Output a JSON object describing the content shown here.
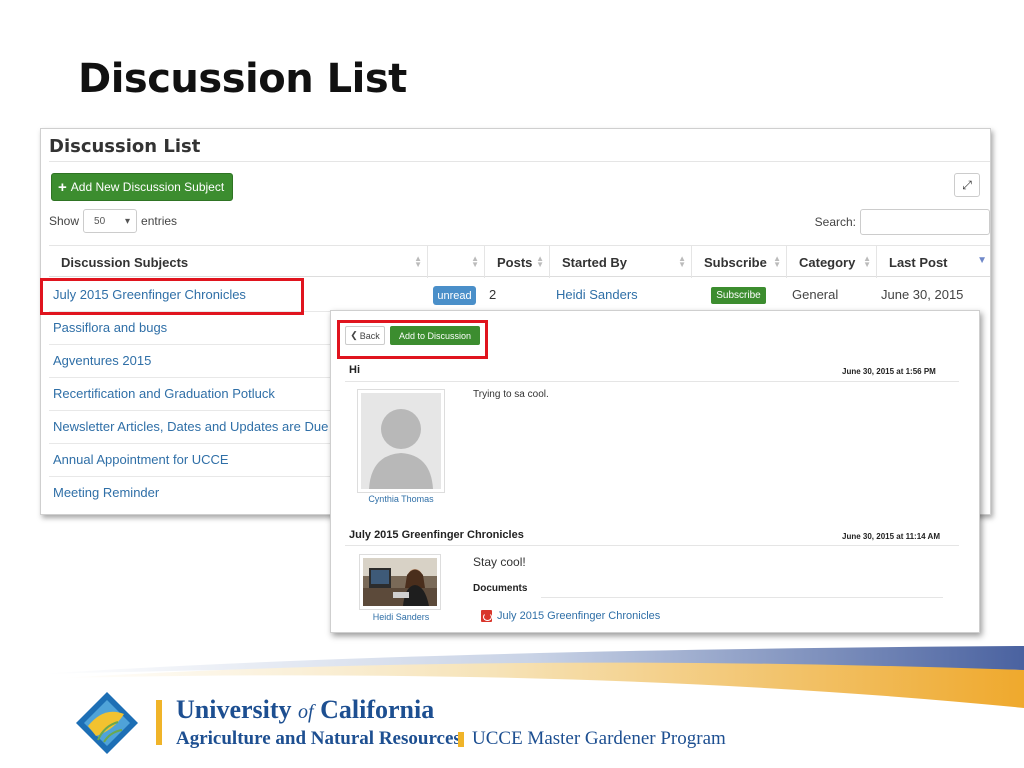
{
  "slide": {
    "title": "Discussion List"
  },
  "list_screen": {
    "heading": "Discussion List",
    "add_button": "Add New Discussion Subject",
    "show_label": "Show",
    "show_value": "50",
    "entries_label": "entries",
    "search_label": "Search:",
    "columns": [
      "Discussion Subjects",
      "",
      "Posts",
      "Started By",
      "Subscribe",
      "Category",
      "Last Post"
    ],
    "first_row": {
      "status": "unread",
      "posts": "2",
      "started_by": "Heidi Sanders",
      "subscribe": "Subscribe",
      "category": "General",
      "last_post": "June 30, 2015"
    },
    "subjects": [
      "July 2015 Greenfinger Chronicles",
      "Passiflora and bugs",
      "Agventures 2015",
      "Recertification and Graduation Potluck",
      "Newsletter Articles, Dates and Updates are Due",
      "Annual Appointment for UCCE",
      "Meeting Reminder"
    ]
  },
  "detail_screen": {
    "back_button": "Back",
    "add_button": "Add to Discussion",
    "posts": [
      {
        "title": "Hi",
        "date": "June 30, 2015 at 1:56 PM",
        "message": "Trying to sa cool.",
        "author": "Cynthia Thomas"
      },
      {
        "title": "July 2015 Greenfinger Chronicles",
        "date": "June 30, 2015 at 11:14 AM",
        "message": "Stay cool!",
        "author": "Heidi Sanders",
        "documents_label": "Documents",
        "document": "July 2015 Greenfinger Chronicles"
      }
    ]
  },
  "footer": {
    "university": "University",
    "of": "of",
    "california": "California",
    "division": "Agriculture and Natural Resources",
    "program": "UCCE Master Gardener Program"
  },
  "colors": {
    "accent_red": "#e0141e",
    "green": "#3c8d2f",
    "link_blue": "#2f6fa7",
    "uc_blue": "#1d4f91",
    "uc_gold": "#f0b429"
  }
}
